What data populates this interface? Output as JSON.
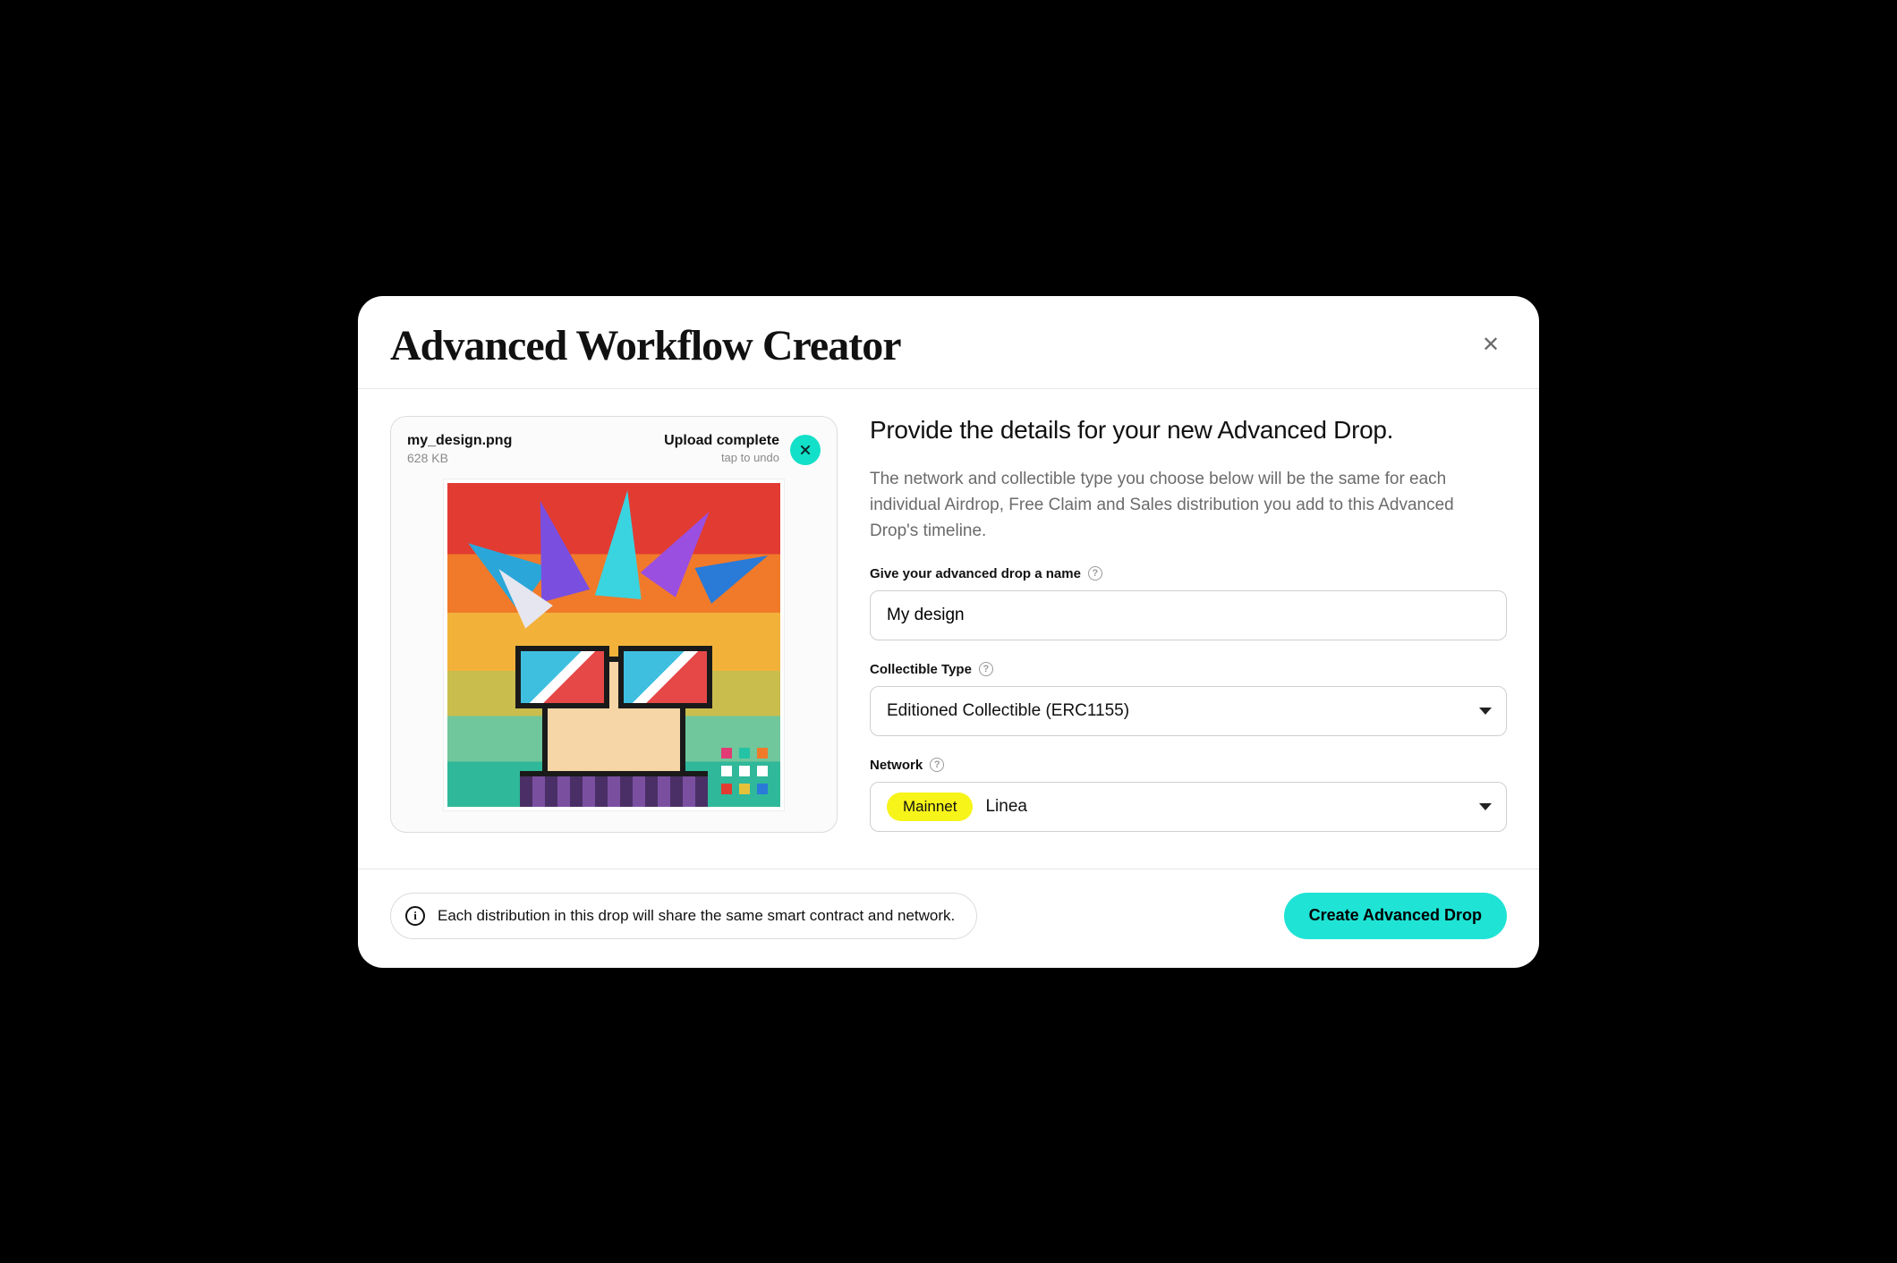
{
  "modal": {
    "title": "Advanced Workflow Creator"
  },
  "upload": {
    "file_name": "my_design.png",
    "file_size": "628 KB",
    "status": "Upload complete",
    "undo_hint": "tap to undo"
  },
  "form": {
    "heading": "Provide the details for your new Advanced Drop.",
    "description": "The network and collectible type you choose below will be the same for each individual Airdrop, Free Claim and Sales distribution you add to this Advanced Drop's timeline.",
    "name_field": {
      "label": "Give your advanced drop a name",
      "value": "My design"
    },
    "type_field": {
      "label": "Collectible Type",
      "selected": "Editioned Collectible (ERC1155)"
    },
    "network_field": {
      "label": "Network",
      "badge": "Mainnet",
      "selected": "Linea"
    }
  },
  "footer": {
    "info": "Each distribution in this drop will share the same smart contract and network.",
    "primary": "Create Advanced Drop"
  },
  "colors": {
    "accent": "#1fe3d5",
    "highlight": "#f7f41a"
  }
}
